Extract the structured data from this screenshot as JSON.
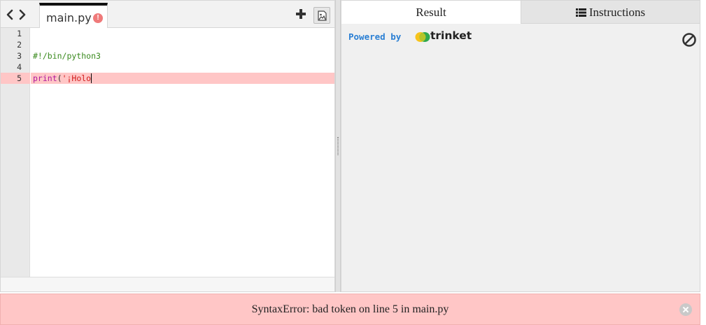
{
  "editor": {
    "active_file": "main.py",
    "line_numbers": [
      "1",
      "2",
      "3",
      "4",
      "5"
    ],
    "code": {
      "line3_comment": "#!/bin/python3",
      "line5_builtin": "print",
      "line5_paren": "(",
      "line5_string": "'¡Holo"
    },
    "error_line": "5"
  },
  "output": {
    "tabs": {
      "result": "Result",
      "instructions": "Instructions"
    },
    "active_tab": "Result",
    "powered_by": "Powered by",
    "brand": "trinket"
  },
  "error_bar": {
    "message": "SyntaxError: bad token on line 5 in main.py"
  },
  "colors": {
    "error_background": "#ffc6c6",
    "link_blue": "#2a7fd4",
    "logo_yellow": "#f7c31b",
    "logo_green": "#2fa84f"
  },
  "icons": [
    "chevron-left-icon",
    "chevron-right-icon",
    "error-icon",
    "plus-icon",
    "image-icon",
    "list-icon",
    "trinket-logo-icon",
    "clear-icon",
    "close-icon"
  ]
}
